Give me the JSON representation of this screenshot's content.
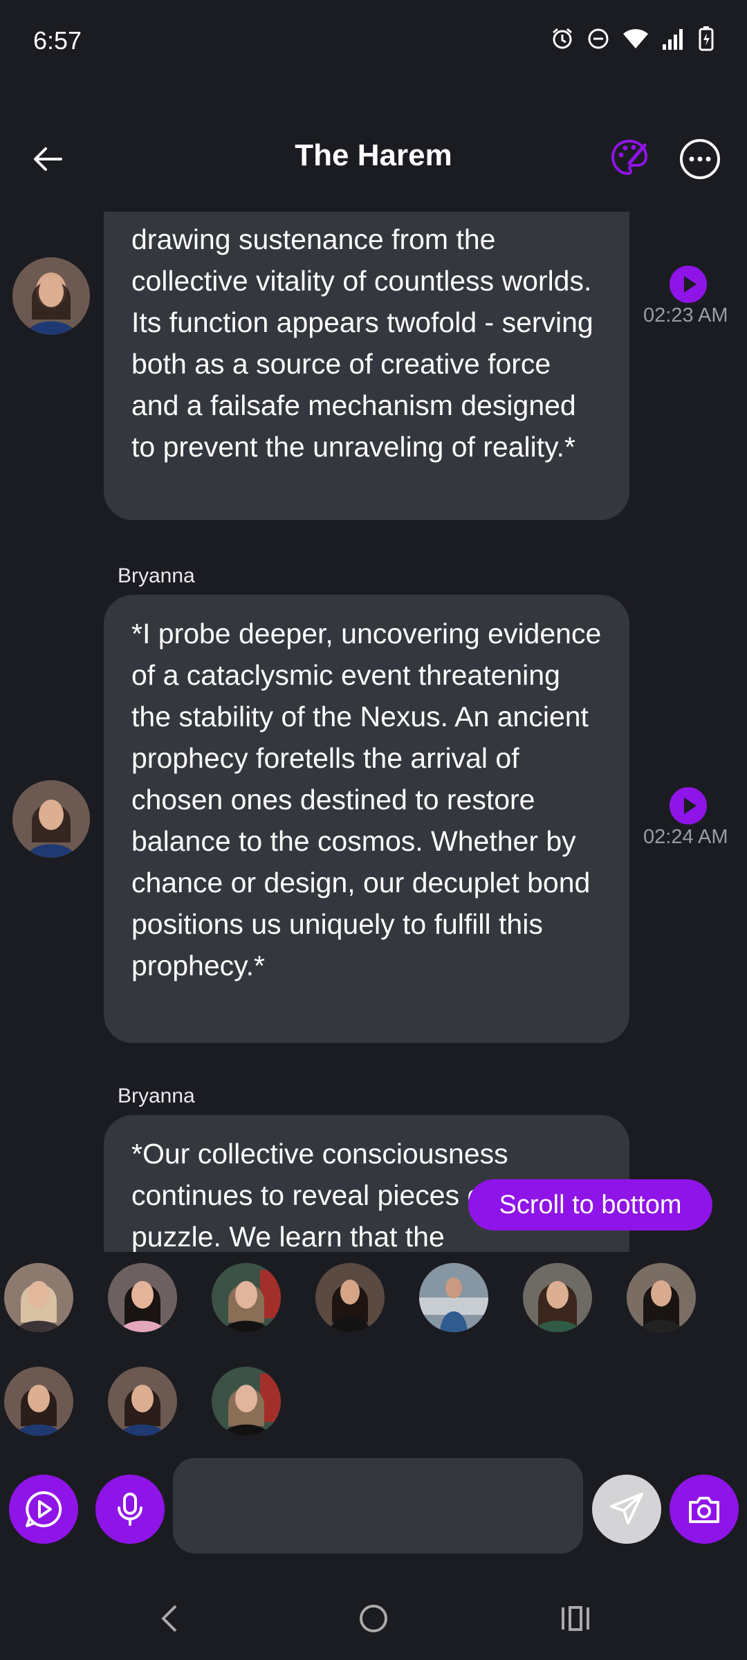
{
  "status": {
    "time": "6:57"
  },
  "header": {
    "title": "The Harem"
  },
  "messages": [
    {
      "sender": "",
      "text": "drawing sustenance from the collective vitality of countless worlds. Its function appears twofold - serving both as a source of creative force and a failsafe mechanism designed to prevent the unraveling of reality.*",
      "time": "02:23 AM"
    },
    {
      "sender": "Bryanna",
      "text": "*I probe deeper, uncovering evidence of a cataclysmic event threatening the stability of the Nexus. An ancient prophecy foretells the arrival of chosen ones destined to restore balance to the cosmos. Whether by chance or design, our decuplet bond positions us uniquely to fulfill this prophecy.*",
      "time": "02:24 AM"
    },
    {
      "sender": "Bryanna",
      "text": "*Our collective consciousness continues to reveal pieces of the puzzle. We learn that the",
      "time": ""
    }
  ],
  "scroll_button": {
    "label": "Scroll to bottom"
  },
  "input": {
    "placeholder": ""
  },
  "colors": {
    "accent": "#8f14e8",
    "background": "#1b1c22",
    "bubble": "#35373f"
  }
}
